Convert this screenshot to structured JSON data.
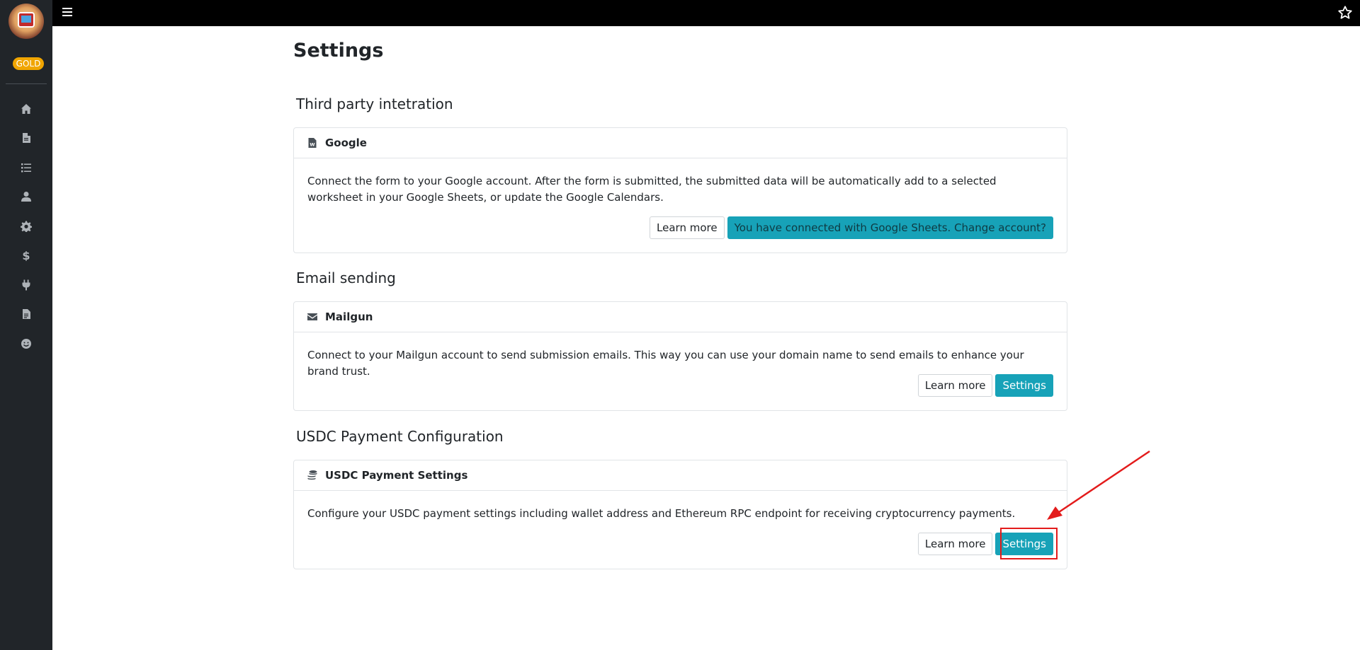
{
  "sidebar": {
    "badge": "GOLD",
    "items": [
      {
        "name": "home-icon"
      },
      {
        "name": "document-icon"
      },
      {
        "name": "list-icon"
      },
      {
        "name": "user-icon"
      },
      {
        "name": "gear-icon"
      },
      {
        "name": "dollar-icon"
      },
      {
        "name": "plug-icon"
      },
      {
        "name": "file-icon"
      },
      {
        "name": "smiley-icon"
      }
    ]
  },
  "page": {
    "title": "Settings"
  },
  "sections": {
    "third_party": {
      "title": "Third party intetration",
      "card_title": "Google",
      "description": "Connect the form to your Google account. After the form is submitted, the submitted data will be automatically add to a selected worksheet in your Google Sheets, or update the Google Calendars.",
      "learn_more": "Learn more",
      "action": "You have connected with Google Sheets. Change account?"
    },
    "email": {
      "title": "Email sending",
      "card_title": "Mailgun",
      "description": "Connect to your Mailgun account to send submission emails. This way you can use your domain name to send emails to enhance your brand trust.",
      "learn_more": "Learn more",
      "action": "Settings"
    },
    "usdc": {
      "title": "USDC Payment Configuration",
      "card_title": "USDC Payment Settings",
      "description": "Configure your USDC payment settings including wallet address and Ethereum RPC endpoint for receiving cryptocurrency payments.",
      "learn_more": "Learn more",
      "action": "Settings"
    }
  },
  "colors": {
    "sidebar": "#212529",
    "topbar": "#000000",
    "accent": "#17a2b8",
    "badge": "#f0a500",
    "highlight": "#e31b1b"
  }
}
